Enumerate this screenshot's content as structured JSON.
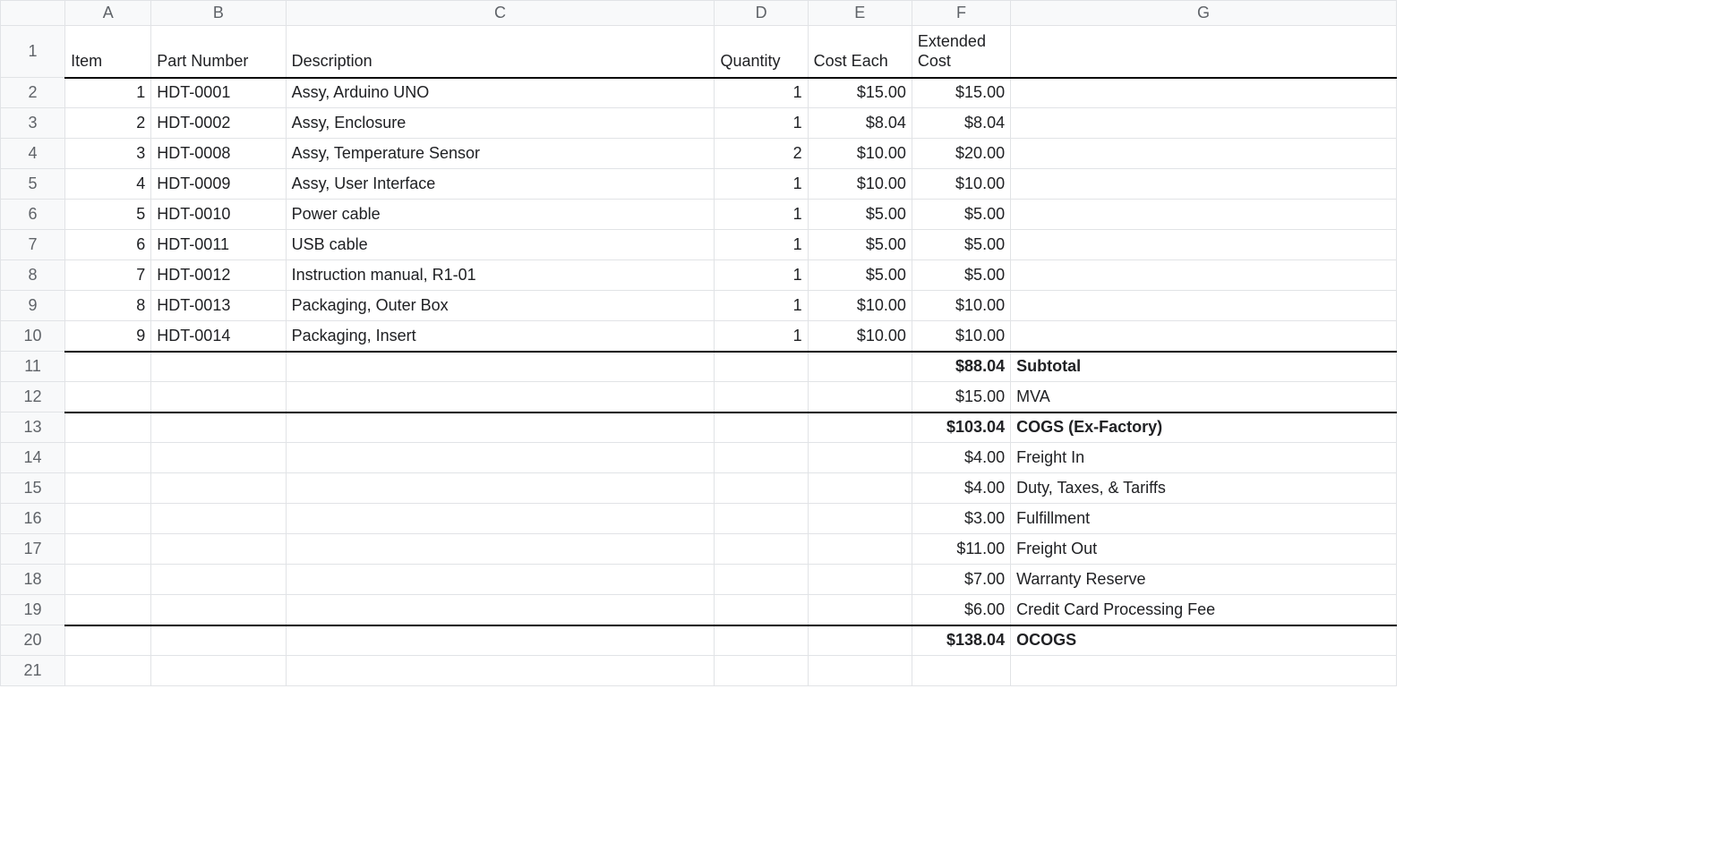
{
  "columns": [
    "A",
    "B",
    "C",
    "D",
    "E",
    "F",
    "G"
  ],
  "row_numbers": [
    "1",
    "2",
    "3",
    "4",
    "5",
    "6",
    "7",
    "8",
    "9",
    "10",
    "11",
    "12",
    "13",
    "14",
    "15",
    "16",
    "17",
    "18",
    "19",
    "20",
    "21"
  ],
  "header": {
    "A": "Item",
    "B": "Part Number",
    "C": "Description",
    "D": "Quantity",
    "E": "Cost Each",
    "F": "Extended Cost",
    "G": ""
  },
  "items": [
    {
      "item": "1",
      "part": "HDT-0001",
      "desc": "Assy, Arduino UNO",
      "qty": "1",
      "cost": "$15.00",
      "ext": "$15.00"
    },
    {
      "item": "2",
      "part": "HDT-0002",
      "desc": "Assy, Enclosure",
      "qty": "1",
      "cost": "$8.04",
      "ext": "$8.04"
    },
    {
      "item": "3",
      "part": "HDT-0008",
      "desc": "Assy, Temperature Sensor",
      "qty": "2",
      "cost": "$10.00",
      "ext": "$20.00"
    },
    {
      "item": "4",
      "part": "HDT-0009",
      "desc": "Assy, User Interface",
      "qty": "1",
      "cost": "$10.00",
      "ext": "$10.00"
    },
    {
      "item": "5",
      "part": "HDT-0010",
      "desc": "Power cable",
      "qty": "1",
      "cost": "$5.00",
      "ext": "$5.00"
    },
    {
      "item": "6",
      "part": "HDT-0011",
      "desc": "USB cable",
      "qty": "1",
      "cost": "$5.00",
      "ext": "$5.00"
    },
    {
      "item": "7",
      "part": "HDT-0012",
      "desc": "Instruction manual, R1-01",
      "qty": "1",
      "cost": "$5.00",
      "ext": "$5.00"
    },
    {
      "item": "8",
      "part": "HDT-0013",
      "desc": "Packaging, Outer Box",
      "qty": "1",
      "cost": "$10.00",
      "ext": "$10.00"
    },
    {
      "item": "9",
      "part": "HDT-0014",
      "desc": "Packaging, Insert",
      "qty": "1",
      "cost": "$10.00",
      "ext": "$10.00"
    }
  ],
  "summary": [
    {
      "row": "11",
      "F": "$88.04",
      "G": "Subtotal",
      "bold": true,
      "sep": true
    },
    {
      "row": "12",
      "F": "$15.00",
      "G": "MVA",
      "bold": false,
      "sep": false
    },
    {
      "row": "13",
      "F": "$103.04",
      "G": "COGS  (Ex-Factory)",
      "bold": true,
      "sep": true
    },
    {
      "row": "14",
      "F": "$4.00",
      "G": "Freight In",
      "bold": false,
      "sep": false
    },
    {
      "row": "15",
      "F": "$4.00",
      "G": "Duty, Taxes, & Tariffs",
      "bold": false,
      "sep": false
    },
    {
      "row": "16",
      "F": "$3.00",
      "G": "Fulfillment",
      "bold": false,
      "sep": false
    },
    {
      "row": "17",
      "F": "$11.00",
      "G": "Freight Out",
      "bold": false,
      "sep": false
    },
    {
      "row": "18",
      "F": "$7.00",
      "G": "Warranty Reserve",
      "bold": false,
      "sep": false
    },
    {
      "row": "19",
      "F": "$6.00",
      "G": "Credit Card Processing Fee",
      "bold": false,
      "sep": false
    },
    {
      "row": "20",
      "F": "$138.04",
      "G": "OCOGS",
      "bold": true,
      "sep": true
    }
  ]
}
